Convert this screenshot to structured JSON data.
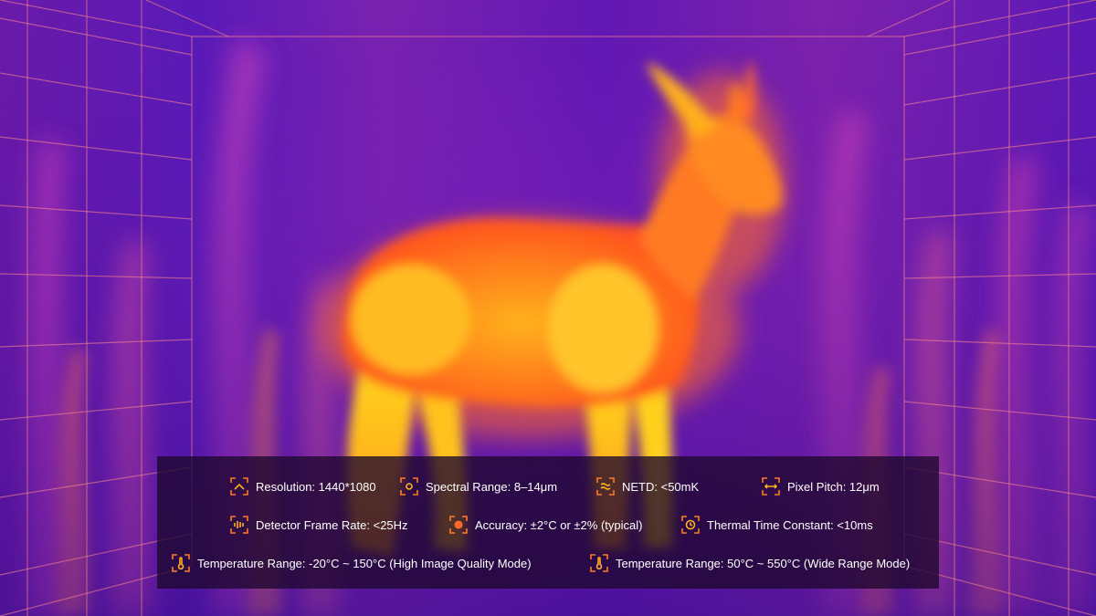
{
  "scene": {
    "subject": "thermal-deer",
    "palette": {
      "cold": "#4a18c8",
      "mid": "#a828c0",
      "warm": "#ff5a1e",
      "hot": "#ffd21a"
    }
  },
  "specs": {
    "row1": [
      {
        "icon": "resolution-icon",
        "text": "Resolution: 1440*1080"
      },
      {
        "icon": "spectrum-icon",
        "text": "Spectral Range: 8–14μm"
      },
      {
        "icon": "netd-icon",
        "text": "NETD: <50mK"
      },
      {
        "icon": "pixel-pitch-icon",
        "text": "Pixel Pitch: 12μm"
      }
    ],
    "row2": [
      {
        "icon": "frame-rate-icon",
        "text": "Detector Frame Rate: <25Hz"
      },
      {
        "icon": "accuracy-icon",
        "text": "Accuracy: ±2°C or ±2% (typical)"
      },
      {
        "icon": "time-constant-icon",
        "text": "Thermal Time Constant: <10ms"
      }
    ],
    "row3": [
      {
        "icon": "thermometer-icon",
        "text": "Temperature Range:  -20°C ~ 150°C (High Image Quality Mode)"
      },
      {
        "icon": "thermometer-icon",
        "text": "Temperature Range:  50°C ~ 550°C (Wide Range Mode)"
      }
    ]
  }
}
